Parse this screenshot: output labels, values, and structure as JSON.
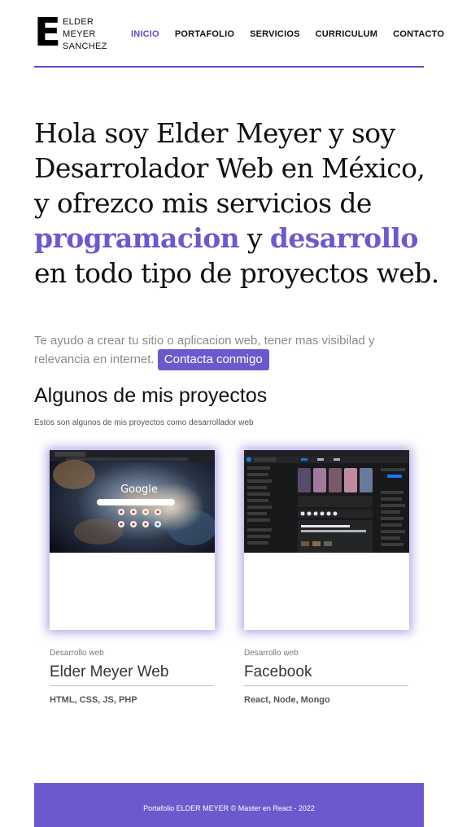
{
  "header": {
    "logo_letter": "E",
    "logo_lines": [
      "ELDER",
      "MEYER",
      "SANCHEZ"
    ],
    "nav": [
      "INICIO",
      "PORTAFOLIO",
      "SERVICIOS",
      "CURRICULUM",
      "CONTACTO"
    ],
    "active": "INICIO"
  },
  "hero": {
    "text_1": "Hola soy Elder Meyer y soy Desarrolador Web en México, y ofrezco mis servicios de ",
    "accent_1": "programacion",
    "text_2": " y ",
    "accent_2": "desarrollo",
    "text_3": " en todo tipo de proyectos web."
  },
  "subtitle": {
    "text": "Te ayudo a crear tu sitio o aplicacion web, tener mas visibilad y relevancia en internet.",
    "button": "Contacta conmigo"
  },
  "projects": {
    "title": "Algunos de mis proyectos",
    "subtitle": "Estos son algunos de mis proyectos como desarrollador web",
    "items": [
      {
        "category": "Desarrollo web",
        "name": "Elder Meyer Web",
        "tech": "HTML, CSS, JS, PHP",
        "thumb_label": "Google"
      },
      {
        "category": "Desarrollo web",
        "name": "Facebook",
        "tech": "React, Node, Mongo"
      }
    ]
  },
  "footer": {
    "text": "Portafolio ELDER MEYER © Master en React - 2022"
  },
  "colors": {
    "accent": "#6a5acd",
    "nav_active": "#5b4fc9"
  }
}
